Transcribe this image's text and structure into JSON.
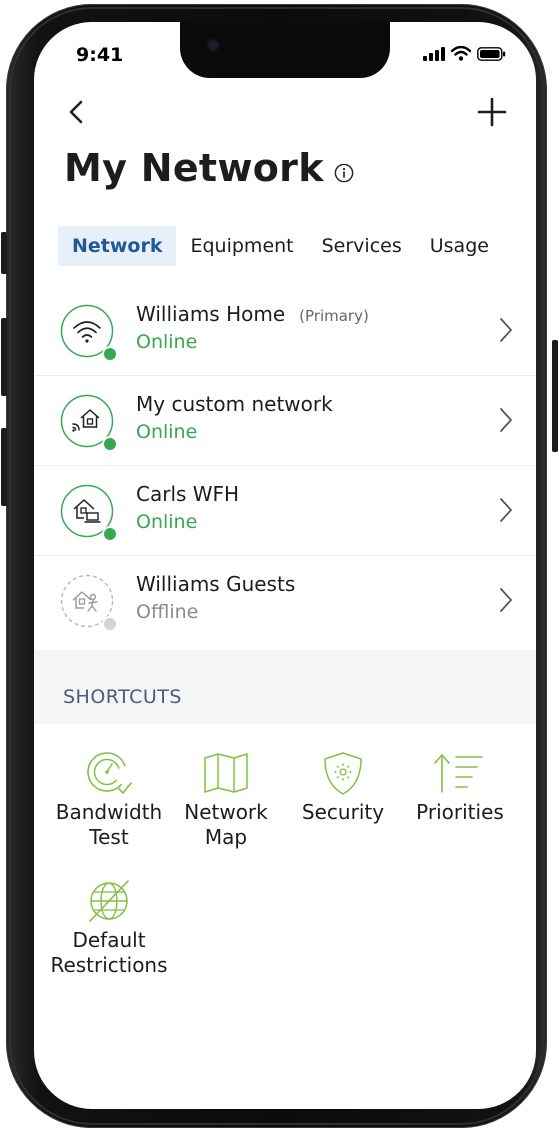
{
  "status_bar": {
    "time": "9:41"
  },
  "header": {
    "title": "My Network",
    "back_icon": "chevron-left-icon",
    "add_icon": "plus-icon",
    "info_icon": "info-icon"
  },
  "tabs": [
    {
      "label": "Network",
      "active": true
    },
    {
      "label": "Equipment",
      "active": false
    },
    {
      "label": "Services",
      "active": false
    },
    {
      "label": "Usage",
      "active": false
    }
  ],
  "networks": [
    {
      "name": "Williams Home",
      "tag": "(Primary)",
      "status": "Online",
      "icon": "wifi-icon"
    },
    {
      "name": "My custom network",
      "tag": "",
      "status": "Online",
      "icon": "house-wifi-icon"
    },
    {
      "name": "Carls WFH",
      "tag": "",
      "status": "Online",
      "icon": "house-laptop-icon"
    },
    {
      "name": "Williams Guests",
      "tag": "",
      "status": "Offline",
      "icon": "house-guest-icon"
    }
  ],
  "shortcuts": {
    "label": "SHORTCUTS",
    "items": [
      {
        "line1": "Bandwidth",
        "line2": "Test",
        "icon": "speedometer-icon"
      },
      {
        "line1": "Network",
        "line2": "Map",
        "icon": "map-icon"
      },
      {
        "line1": "Security",
        "line2": "",
        "icon": "shield-icon"
      },
      {
        "line1": "Priorities",
        "line2": "",
        "icon": "priorities-icon"
      },
      {
        "line1": "Default",
        "line2": "Restrictions",
        "icon": "globe-restricted-icon"
      }
    ]
  },
  "colors": {
    "accent": "#1f5a96",
    "online": "#36a852",
    "offline": "#8a8a8a",
    "icon_green": "#7fc241",
    "tab_active_bg": "#e7eff8"
  }
}
